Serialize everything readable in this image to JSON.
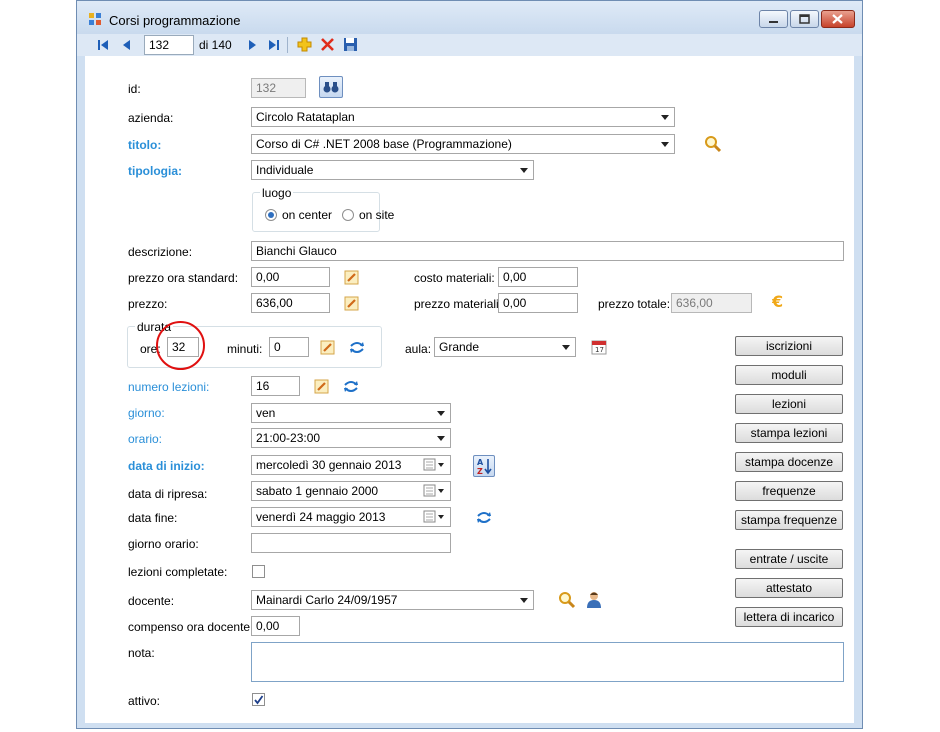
{
  "window": {
    "title": "Corsi programmazione"
  },
  "toolbar": {
    "position": "132",
    "of_label": "di 140"
  },
  "icons": [
    "first-record-icon",
    "prev-record-icon",
    "next-record-icon",
    "last-record-icon",
    "add-icon",
    "delete-icon",
    "save-icon",
    "binoculars-icon",
    "search-icon",
    "edit-icon",
    "refresh-icon",
    "calendar-icon",
    "sort-az-icon",
    "person-icon",
    "euro-icon"
  ],
  "form": {
    "id": {
      "label": "id:",
      "value": "132"
    },
    "azienda": {
      "label": "azienda:",
      "value": "Circolo Ratataplan"
    },
    "titolo": {
      "label": "titolo:",
      "value": "Corso di C# .NET 2008 base (Programmazione)"
    },
    "tipologia": {
      "label": "tipologia:",
      "value": "Individuale"
    },
    "luogo": {
      "label": "luogo",
      "opt1": "on center",
      "opt2": "on site"
    },
    "descrizione": {
      "label": "descrizione:",
      "value": "Bianchi Glauco"
    },
    "prezzo_ora": {
      "label": "prezzo ora standard:",
      "value": "0,00"
    },
    "costo_materiali": {
      "label": "costo materiali:",
      "value": "0,00"
    },
    "prezzo": {
      "label": "prezzo:",
      "value": "636,00"
    },
    "prezzo_materiali": {
      "label": "prezzo materiali:",
      "value": "0,00"
    },
    "prezzo_totale": {
      "label": "prezzo totale:",
      "value": "636,00"
    },
    "durata": {
      "label": "durata",
      "ore_label": "ore:",
      "ore": "32",
      "minuti_label": "minuti:",
      "minuti": "0"
    },
    "aula": {
      "label": "aula:",
      "value": "Grande"
    },
    "numero_lezioni": {
      "label": "numero lezioni:",
      "value": "16"
    },
    "giorno": {
      "label": "giorno:",
      "value": "ven"
    },
    "orario": {
      "label": "orario:",
      "value": "21:00-23:00"
    },
    "data_inizio": {
      "label": "data di inizio:",
      "value": "mercoledì 30  gennaio  2013"
    },
    "data_ripresa": {
      "label": "data di ripresa:",
      "value": "  sabato     1  gennaio  2000"
    },
    "data_fine": {
      "label": "data fine:",
      "value": "  venerdì   24   maggio   2013"
    },
    "giorno_orario": {
      "label": "giorno orario:",
      "value": ""
    },
    "lezioni_completate": {
      "label": "lezioni completate:"
    },
    "docente": {
      "label": "docente:",
      "value": "Mainardi Carlo 24/09/1957"
    },
    "compenso": {
      "label": "compenso ora docente:",
      "value": "0,00"
    },
    "nota": {
      "label": "nota:",
      "value": ""
    },
    "attivo": {
      "label": "attivo:"
    }
  },
  "buttons": {
    "iscrizioni": "iscrizioni",
    "moduli": "moduli",
    "lezioni": "lezioni",
    "stampa_lezioni": "stampa lezioni",
    "stampa_docenze": "stampa docenze",
    "frequenze": "frequenze",
    "stampa_frequenze": "stampa frequenze",
    "entrate_uscite": "entrate / uscite",
    "attestato": "attestato",
    "lettera": "lettera di incarico"
  }
}
